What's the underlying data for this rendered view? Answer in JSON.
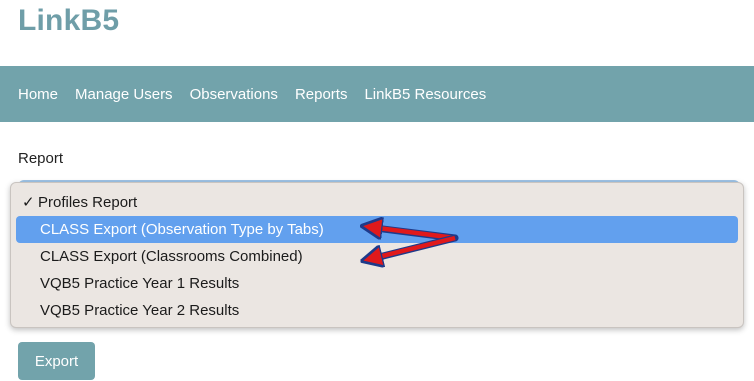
{
  "app": {
    "title": "LinkB5"
  },
  "nav": {
    "items": [
      {
        "label": "Home"
      },
      {
        "label": "Manage Users"
      },
      {
        "label": "Observations"
      },
      {
        "label": "Reports"
      },
      {
        "label": "LinkB5 Resources"
      }
    ]
  },
  "report": {
    "label": "Report",
    "selected": "Profiles Report",
    "options": [
      {
        "label": "Profiles Report",
        "checked": true
      },
      {
        "label": "CLASS Export (Observation Type by Tabs)",
        "highlighted": true
      },
      {
        "label": "CLASS Export (Classrooms Combined)"
      },
      {
        "label": "VQB5 Practice Year 1 Results"
      },
      {
        "label": "VQB5 Practice Year 2 Results"
      }
    ],
    "check_mark": "✓"
  },
  "actions": {
    "export_label": "Export"
  },
  "colors": {
    "brand": "#6f9ea8",
    "navbar": "#72a3ab",
    "highlight": "#62a0ee",
    "annotation_arrow": "#e0191b",
    "annotation_outline": "#1e3a8a"
  }
}
